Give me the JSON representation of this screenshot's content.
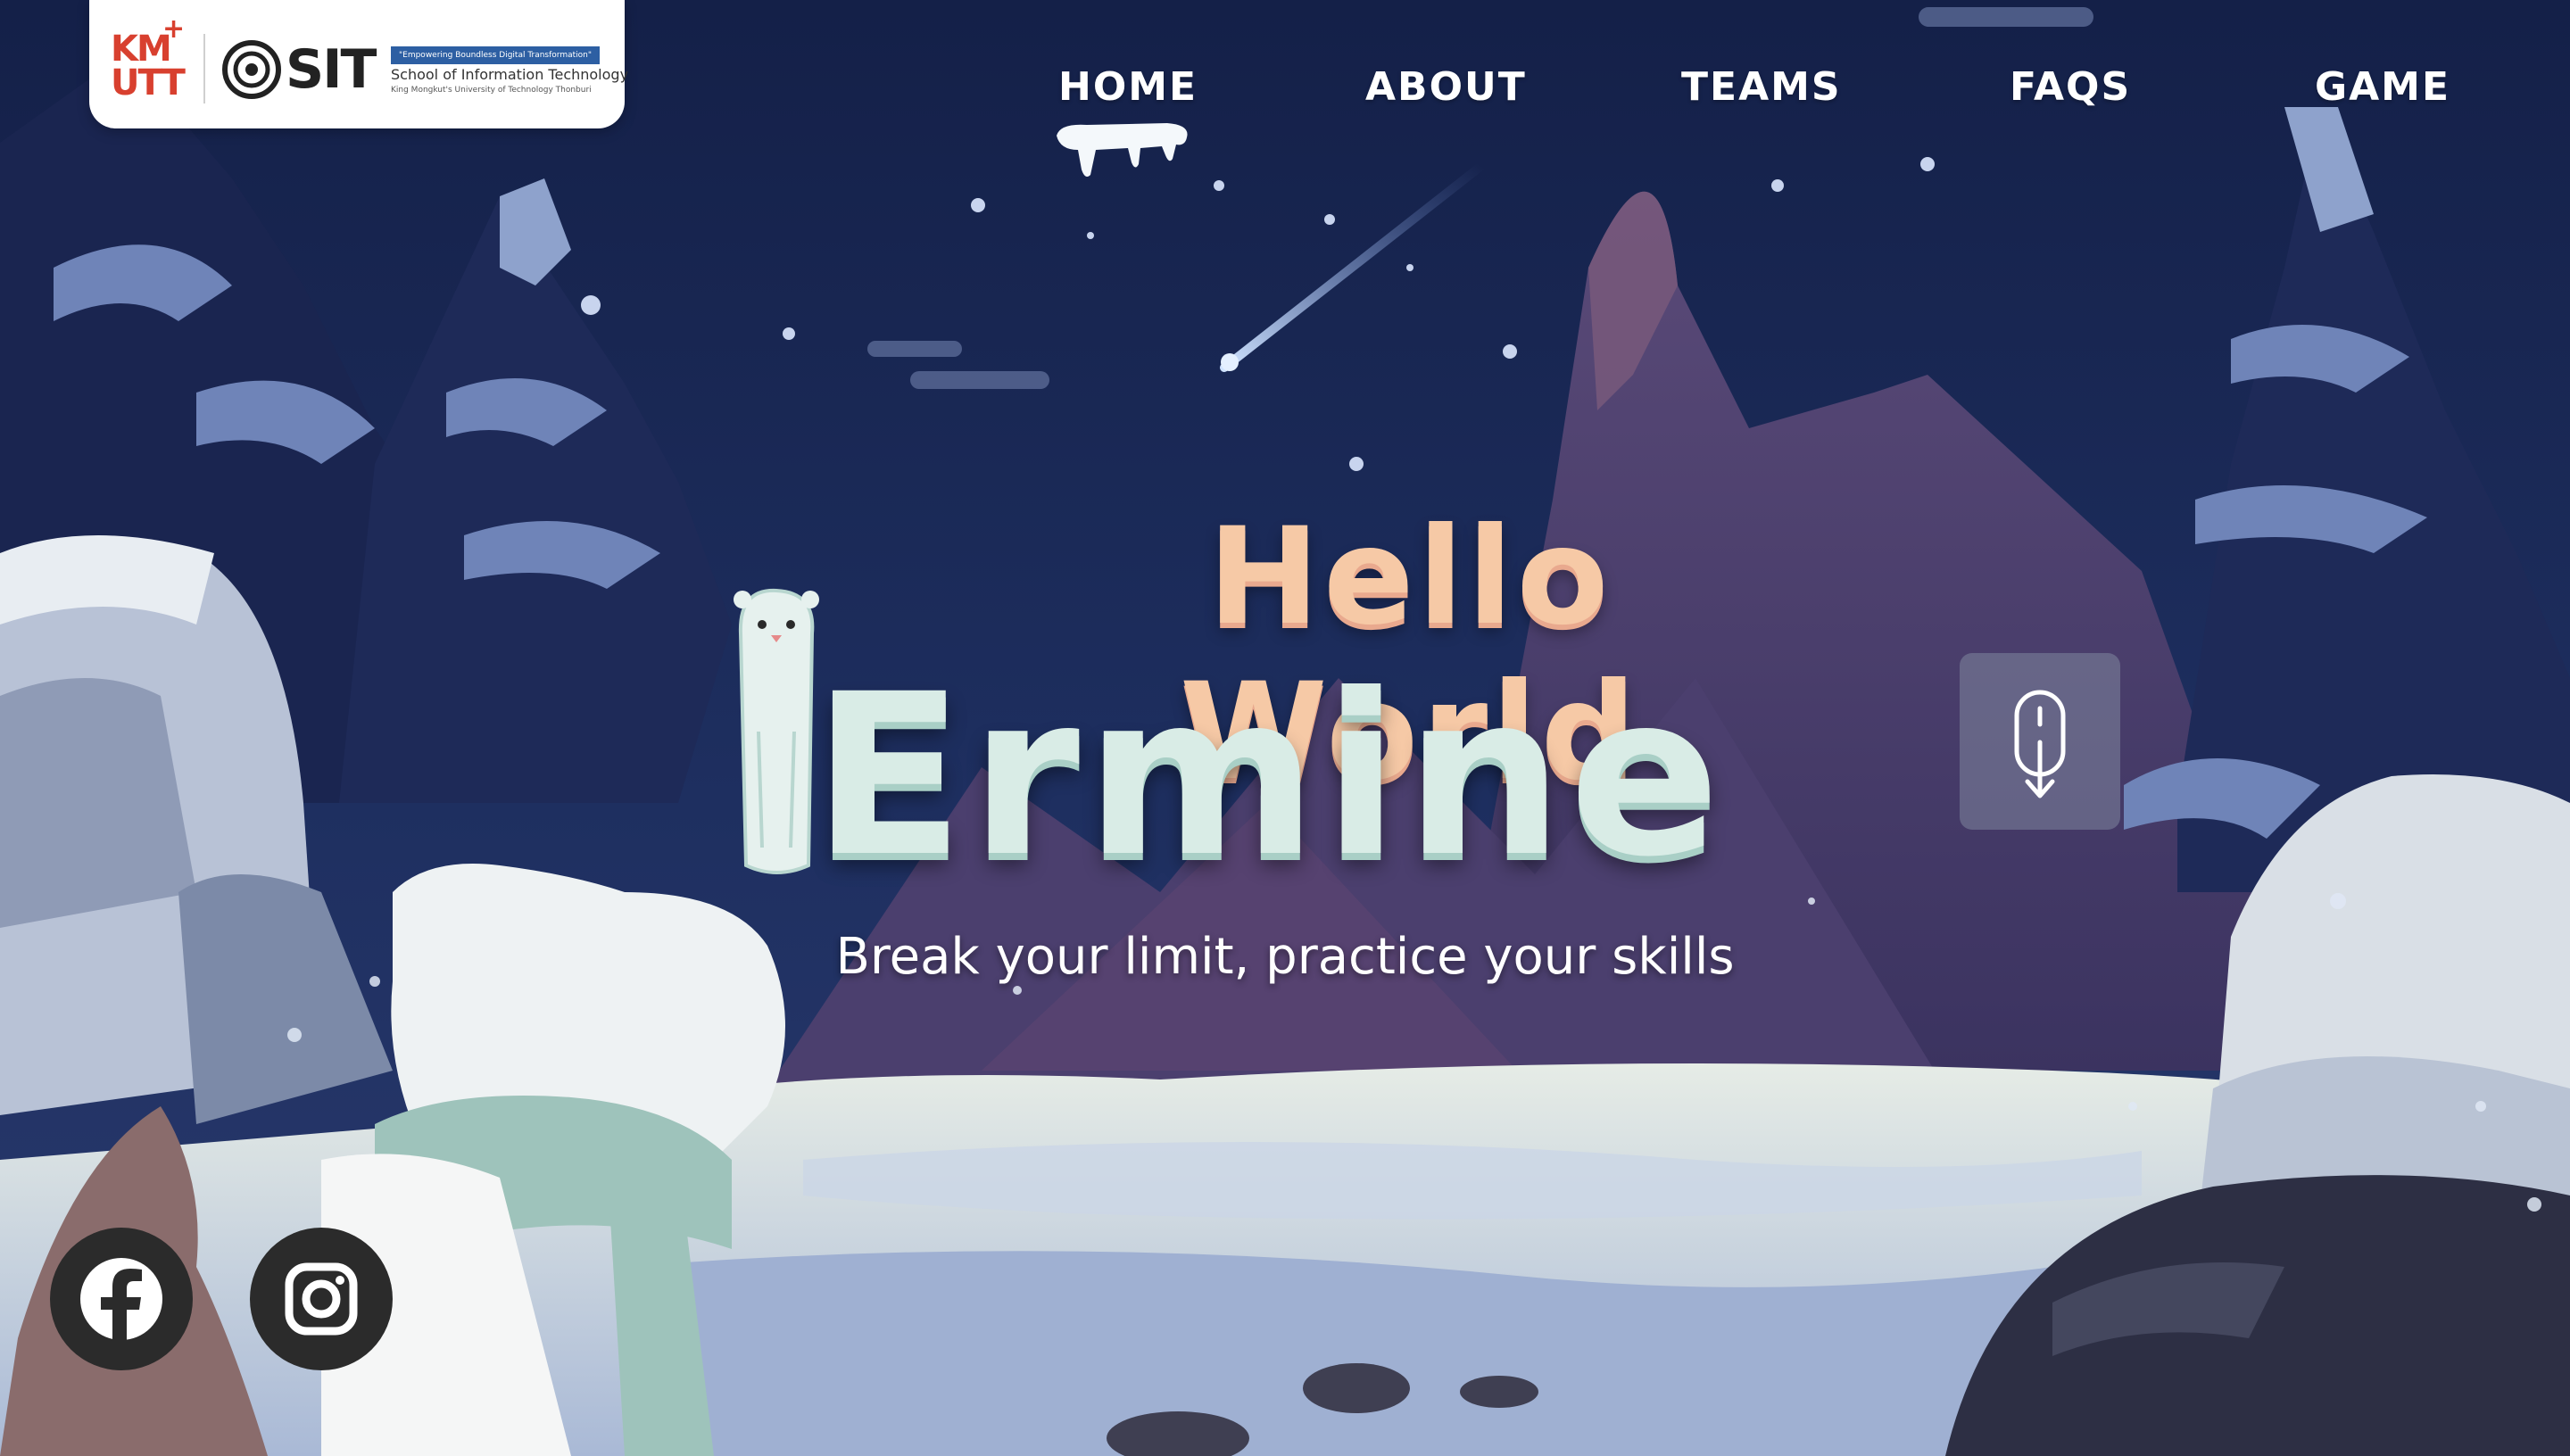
{
  "logo": {
    "kmutt_text": "KM UTT",
    "sit_text": "SIT",
    "tagline": "\"Empowering Boundless Digital Transformation\"",
    "school": "School of Information Technology",
    "university": "King Mongkut's University of Technology Thonburi"
  },
  "nav": {
    "items": [
      {
        "label": "HOME",
        "active": true
      },
      {
        "label": "ABOUT",
        "active": false
      },
      {
        "label": "TEAMS",
        "active": false
      },
      {
        "label": "FAQS",
        "active": false
      },
      {
        "label": "GAME",
        "active": false
      }
    ]
  },
  "hero": {
    "title_line1": "Hello World",
    "title_line2": "Ermine",
    "tagline": "Break your limit, practice your skills"
  },
  "scroll_indicator": {
    "icon": "mouse-scroll-icon"
  },
  "social": [
    {
      "icon": "facebook-icon"
    },
    {
      "icon": "instagram-icon"
    }
  ],
  "colors": {
    "sky": "#16224a",
    "title_peach": "#f6c9a6",
    "title_mint": "#d9ece6",
    "logo_red": "#d8402f",
    "logo_blue": "#2d5fa3"
  }
}
